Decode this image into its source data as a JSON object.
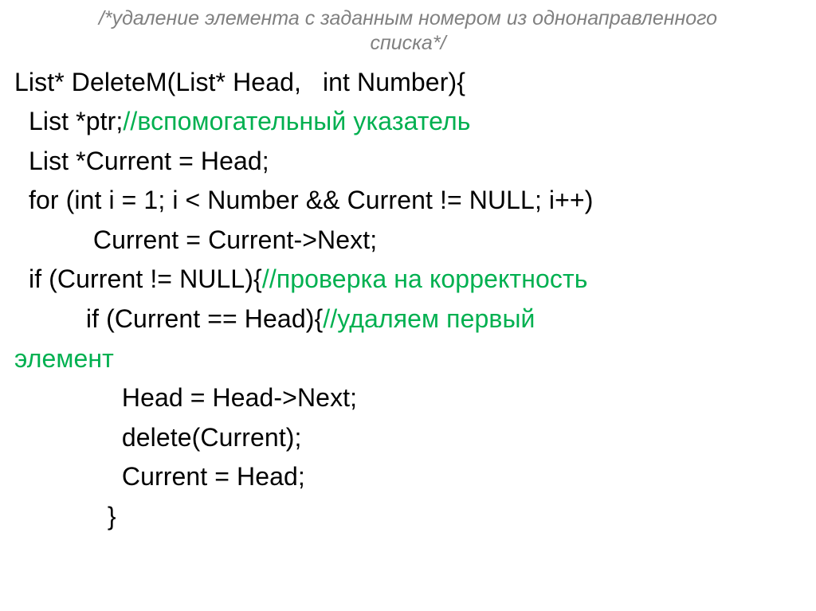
{
  "title_line1": "/*удаление элемента с заданным номером из однонаправленного",
  "title_line2": "списка*/",
  "code": {
    "l1": "List* DeleteM(List* Head,   int Number){",
    "l2a": "  List *ptr;",
    "l2b": "//вспомогательный указатель",
    "l3": "  List *Current = Head;",
    "l4": "  for (int i = 1; i < Number && Current != NULL; i++)",
    "l5": "           Current = Current->Next;",
    "l6a": "  if (Current != NULL){",
    "l6b": "//проверка на корректность",
    "l7a": "          if (Current == Head){",
    "l7b": "//удаляем первый",
    "l7c": "элемент",
    "l8": "               Head = Head->Next;",
    "l9": "               delete(Current);",
    "l10": "               Current = Head;",
    "l11": "             }"
  }
}
